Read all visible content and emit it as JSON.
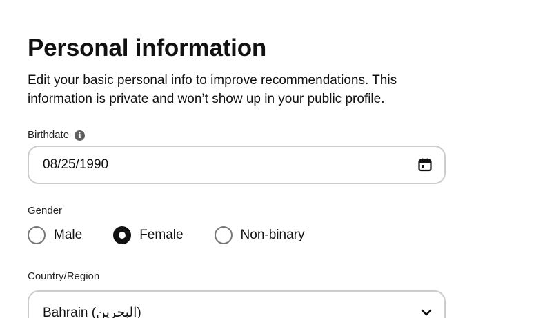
{
  "page": {
    "title": "Personal information",
    "description": "Edit your basic personal info to improve recommendations. This information is private and won’t show up in your public profile."
  },
  "birthdate": {
    "label": "Birthdate",
    "info_icon": "info-icon",
    "value": "08/25/1990",
    "icon": "calendar-icon"
  },
  "gender": {
    "label": "Gender",
    "options": [
      {
        "label": "Male",
        "selected": false
      },
      {
        "label": "Female",
        "selected": true
      },
      {
        "label": "Non-binary",
        "selected": false
      }
    ]
  },
  "country": {
    "label": "Country/Region",
    "value": "Bahrain (البحرين)",
    "icon": "chevron-down-icon"
  }
}
